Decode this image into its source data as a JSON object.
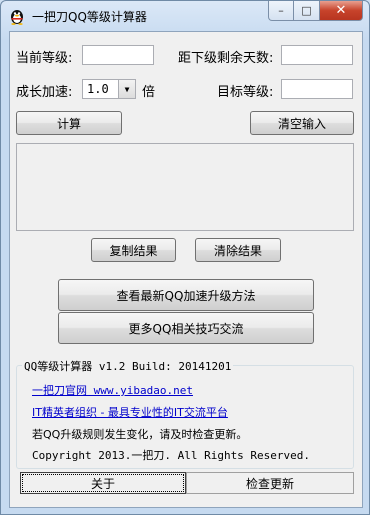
{
  "window": {
    "title": "一把刀QQ等级计算器",
    "icon": "qq-penguin-icon",
    "controls": {
      "minimize": "–",
      "maximize": "□",
      "close": "✕"
    }
  },
  "form": {
    "current_level_label": "当前等级:",
    "current_level_value": "",
    "days_left_label": "距下级剩余天数:",
    "days_left_value": "",
    "speed_label": "成长加速:",
    "speed_value": "1.0",
    "speed_unit": "倍",
    "target_level_label": "目标等级:",
    "target_level_value": ""
  },
  "buttons": {
    "calculate": "计算",
    "clear_input": "清空输入",
    "copy_result": "复制结果",
    "clear_result": "清除结果",
    "view_latest": "查看最新QQ加速升级方法",
    "more_tips": "更多QQ相关技巧交流"
  },
  "result_text": "",
  "about": {
    "group_title": "QQ等级计算器 v1.2 Build: 20141201",
    "link1": "一把刀官网 www.yibadao.net",
    "link2": "IT精英者组织 - 最具专业性的IT交流平台",
    "notice": "若QQ升级规则发生变化，请及时检查更新。",
    "copyright": "Copyright 2013.一把刀. All Rights Reserved."
  },
  "bottom": {
    "about_btn": "关于",
    "check_update_btn": "检查更新"
  }
}
